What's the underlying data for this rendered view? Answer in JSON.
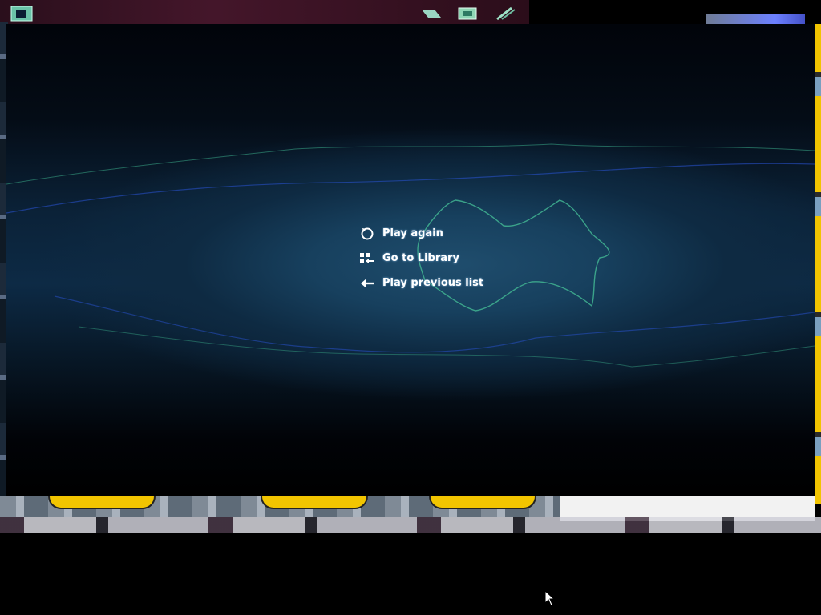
{
  "player": {
    "end_menu": [
      {
        "label": "Play again",
        "icon": "replay-icon"
      },
      {
        "label": "Go to Library",
        "icon": "library-icon"
      },
      {
        "label": "Play previous list",
        "icon": "back-arrow-icon"
      }
    ]
  },
  "colors": {
    "accent": "#1f4d6d",
    "visualizer_line": "#3fae8f",
    "visualizer_blue": "#2a54d6"
  }
}
